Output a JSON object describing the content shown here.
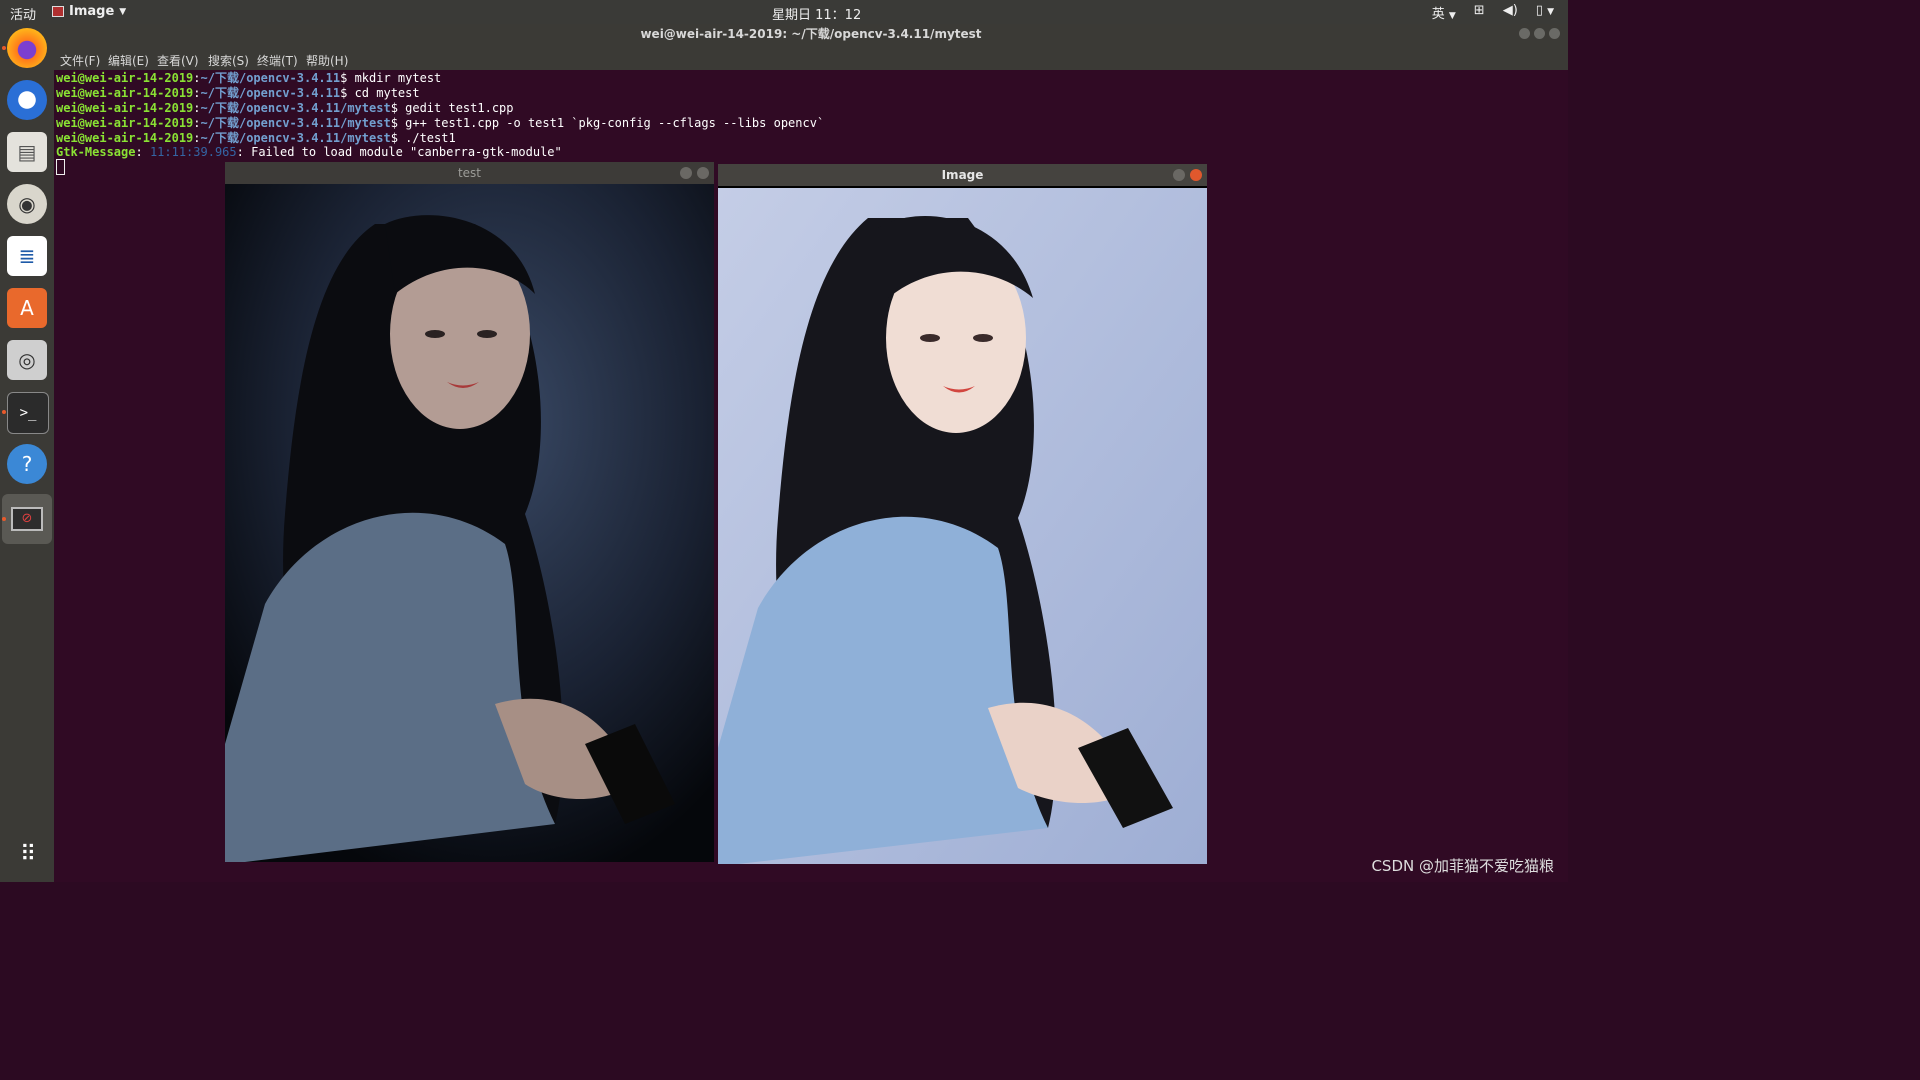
{
  "topbar": {
    "activities": "活动",
    "app_name": "Image",
    "clock": "星期日 11：12",
    "input_method": "英"
  },
  "dock": {
    "icons": [
      "firefox-icon",
      "thunderbird-icon",
      "files-icon",
      "rhythmbox-icon",
      "writer-icon",
      "software-center-icon",
      "camera-icon",
      "terminal-icon",
      "help-icon",
      "image-viewer-icon"
    ],
    "apps_grid": "show-apps"
  },
  "terminal": {
    "title": "wei@wei-air-14-2019: ~/下载/opencv-3.4.11/mytest",
    "menu": [
      "文件(F)",
      "编辑(E)",
      "查看(V)",
      "搜索(S)",
      "终端(T)",
      "帮助(H)"
    ],
    "lines": [
      {
        "user": "wei@wei-air-14-2019",
        "path": "~/下载/opencv-3.4.11",
        "cmd": "$ mkdir mytest"
      },
      {
        "user": "wei@wei-air-14-2019",
        "path": "~/下载/opencv-3.4.11",
        "cmd": "$ cd mytest"
      },
      {
        "user": "wei@wei-air-14-2019",
        "path": "~/下载/opencv-3.4.11/mytest",
        "cmd": "$ gedit test1.cpp"
      },
      {
        "user": "wei@wei-air-14-2019",
        "path": "~/下载/opencv-3.4.11/mytest",
        "cmd": "$ g++ test1.cpp -o test1 `pkg-config --cflags --libs opencv`"
      },
      {
        "user": "wei@wei-air-14-2019",
        "path": "~/下载/opencv-3.4.11/mytest",
        "cmd": "$ ./test1"
      }
    ],
    "gtk": {
      "label": "Gtk-Message",
      "time": "11:11:39.965",
      "msg": ": Failed to load module \"canberra-gtk-module\""
    }
  },
  "windows": {
    "test": {
      "title": "test"
    },
    "image": {
      "title": "Image"
    }
  },
  "colors": {
    "term_bg": "#300a24",
    "accent_close": "#e0582d",
    "user_green": "#8ae234",
    "path_blue": "#729fcf"
  },
  "watermark": "CSDN @加菲猫不爱吃猫粮"
}
